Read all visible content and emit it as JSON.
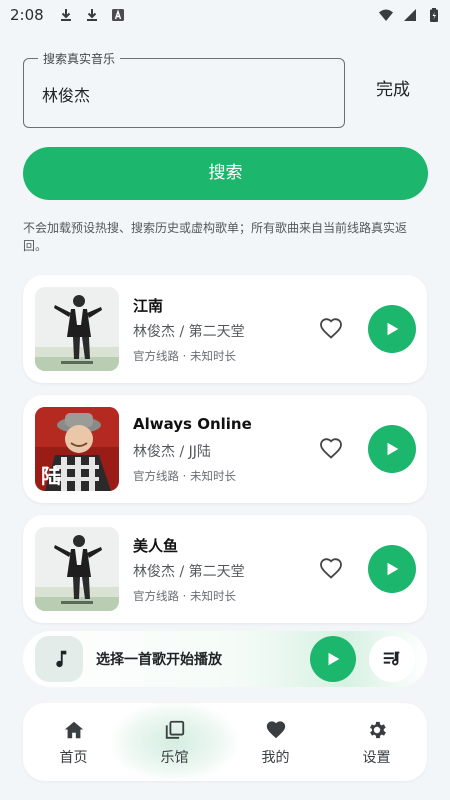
{
  "status_bar": {
    "time": "2:08",
    "left_icons": [
      "download-icon",
      "download-icon",
      "text-a-icon"
    ],
    "right_icons": [
      "wifi-icon",
      "signal-icon",
      "battery-icon"
    ]
  },
  "search": {
    "label": "搜索真实音乐",
    "value": "林俊杰",
    "done_label": "完成",
    "button_label": "搜索"
  },
  "notice": "不会加载预设热搜、搜索历史或虚构歌单；所有歌曲来自当前线路真实返回。",
  "songs": [
    {
      "title": "江南",
      "artist": "林俊杰 / 第二天堂",
      "meta": "官方线路 · 未知时长",
      "liked": false
    },
    {
      "title": "Always Online",
      "artist": "林俊杰 / JJ陆",
      "meta": "官方线路 · 未知时长",
      "liked": false
    },
    {
      "title": "美人鱼",
      "artist": "林俊杰 / 第二天堂",
      "meta": "官方线路 · 未知时长",
      "liked": false
    }
  ],
  "mini_player": {
    "text": "选择一首歌开始播放"
  },
  "nav": {
    "items": [
      {
        "label": "首页",
        "icon": "home-icon"
      },
      {
        "label": "乐馆",
        "icon": "library-icon"
      },
      {
        "label": "我的",
        "icon": "heart-icon"
      },
      {
        "label": "设置",
        "icon": "gear-icon"
      }
    ]
  },
  "colors": {
    "accent": "#1db66d",
    "background": "#f3f6f8",
    "card": "#ffffff"
  }
}
